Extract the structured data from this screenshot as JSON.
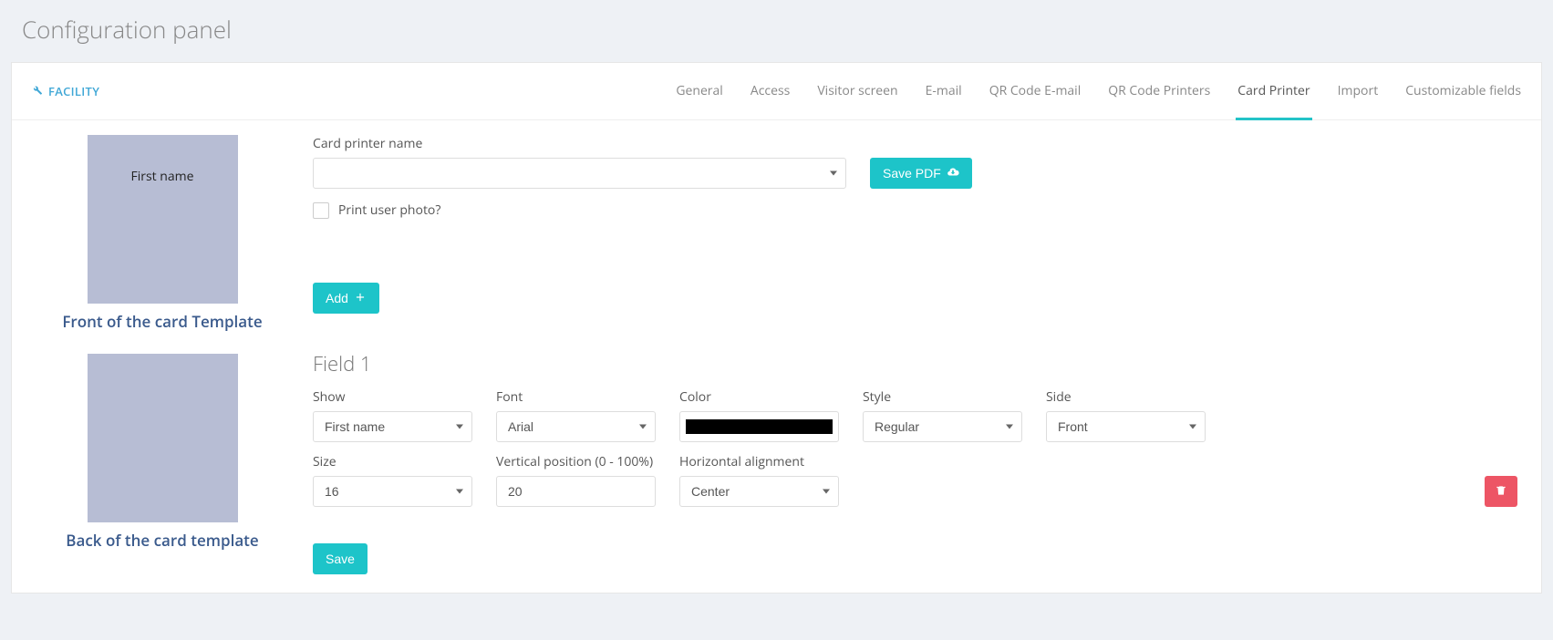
{
  "page": {
    "title": "Configuration panel"
  },
  "header": {
    "facility_label": "FACILITY",
    "tabs": [
      {
        "label": "General",
        "active": false
      },
      {
        "label": "Access",
        "active": false
      },
      {
        "label": "Visitor screen",
        "active": false
      },
      {
        "label": "E-mail",
        "active": false
      },
      {
        "label": "QR Code E-mail",
        "active": false
      },
      {
        "label": "QR Code Printers",
        "active": false
      },
      {
        "label": "Card Printer",
        "active": true
      },
      {
        "label": "Import",
        "active": false
      },
      {
        "label": "Customizable fields",
        "active": false
      }
    ]
  },
  "preview": {
    "front_text": "First name",
    "front_caption": "Front of the card Template",
    "back_caption": "Back of the card template"
  },
  "printer": {
    "name_label": "Card printer name",
    "name_value": "",
    "save_pdf_label": "Save PDF",
    "print_photo_label": "Print user photo?",
    "print_photo_checked": false,
    "add_label": "Add"
  },
  "field1": {
    "title": "Field 1",
    "show": {
      "label": "Show",
      "value": "First name"
    },
    "font": {
      "label": "Font",
      "value": "Arial"
    },
    "color": {
      "label": "Color",
      "value": "#000000"
    },
    "style": {
      "label": "Style",
      "value": "Regular"
    },
    "side": {
      "label": "Side",
      "value": "Front"
    },
    "size": {
      "label": "Size",
      "value": "16"
    },
    "vpos": {
      "label": "Vertical position (0 - 100%)",
      "value": "20"
    },
    "halign": {
      "label": "Horizontal alignment",
      "value": "Center"
    }
  },
  "actions": {
    "save_label": "Save"
  }
}
